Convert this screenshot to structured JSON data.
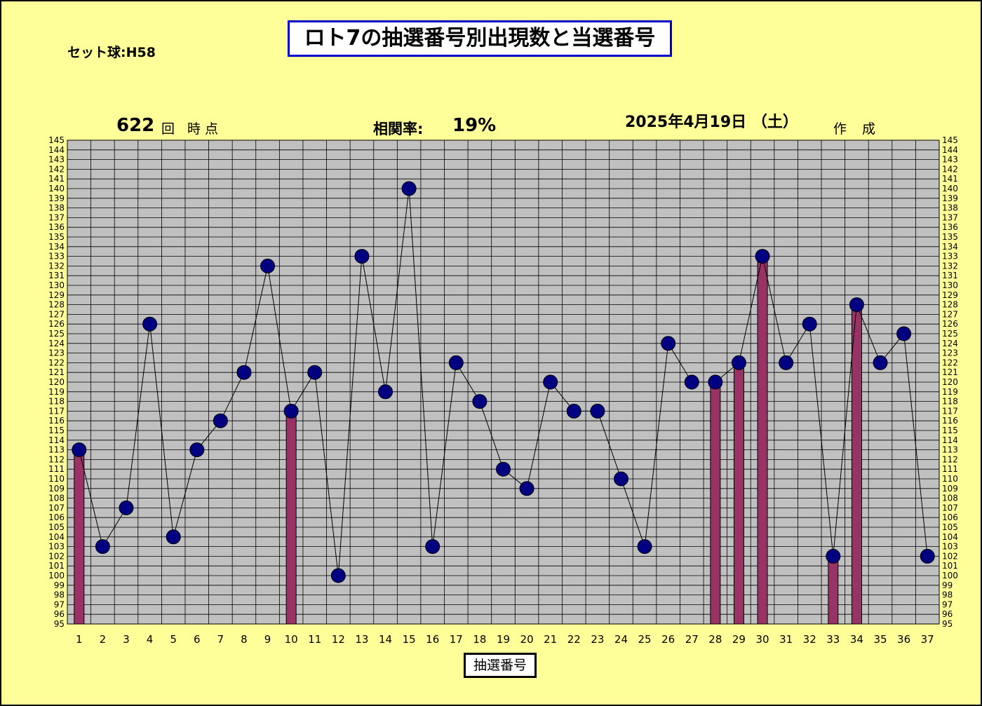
{
  "title": "ロト7の抽選番号別出現数と当選番号",
  "set_ball": "セット球:H58",
  "draw_number": "622",
  "draw_suffix": "回 時点",
  "correlation_label": "相関率:",
  "correlation_value": "19%",
  "date": "2025年4月19日 （土）",
  "created_label": "作 成",
  "colors": {
    "background": "#ffff99",
    "plot_area": "#c0c0c0",
    "bar": "#993366",
    "marker": "#000080",
    "title_border": "#0000cc"
  },
  "chart_data": {
    "type": "bar+line",
    "xlabel": "抽選番号",
    "ylim": [
      95,
      145
    ],
    "ytick_step": 1,
    "y_axes": "left and right",
    "grid": true,
    "categories": [
      "1",
      "2",
      "3",
      "4",
      "5",
      "6",
      "7",
      "8",
      "9",
      "10",
      "11",
      "12",
      "13",
      "14",
      "15",
      "16",
      "17",
      "18",
      "19",
      "20",
      "21",
      "22",
      "23",
      "24",
      "25",
      "26",
      "27",
      "28",
      "29",
      "30",
      "31",
      "32",
      "33",
      "34",
      "35",
      "36",
      "37"
    ],
    "series": [
      {
        "type": "line",
        "values": [
          113,
          103,
          107,
          126,
          104,
          113,
          116,
          121,
          132,
          117,
          121,
          100,
          133,
          119,
          140,
          103,
          122,
          118,
          111,
          109,
          120,
          117,
          117,
          110,
          103,
          124,
          120,
          120,
          122,
          133,
          122,
          126,
          102,
          128,
          122,
          125,
          102
        ]
      },
      {
        "type": "bar",
        "values": [
          113,
          null,
          null,
          null,
          null,
          null,
          null,
          null,
          null,
          117,
          null,
          null,
          null,
          null,
          null,
          null,
          null,
          null,
          null,
          null,
          null,
          null,
          null,
          null,
          null,
          null,
          null,
          120,
          122,
          133,
          null,
          null,
          102,
          128,
          null,
          null,
          null
        ]
      }
    ]
  }
}
